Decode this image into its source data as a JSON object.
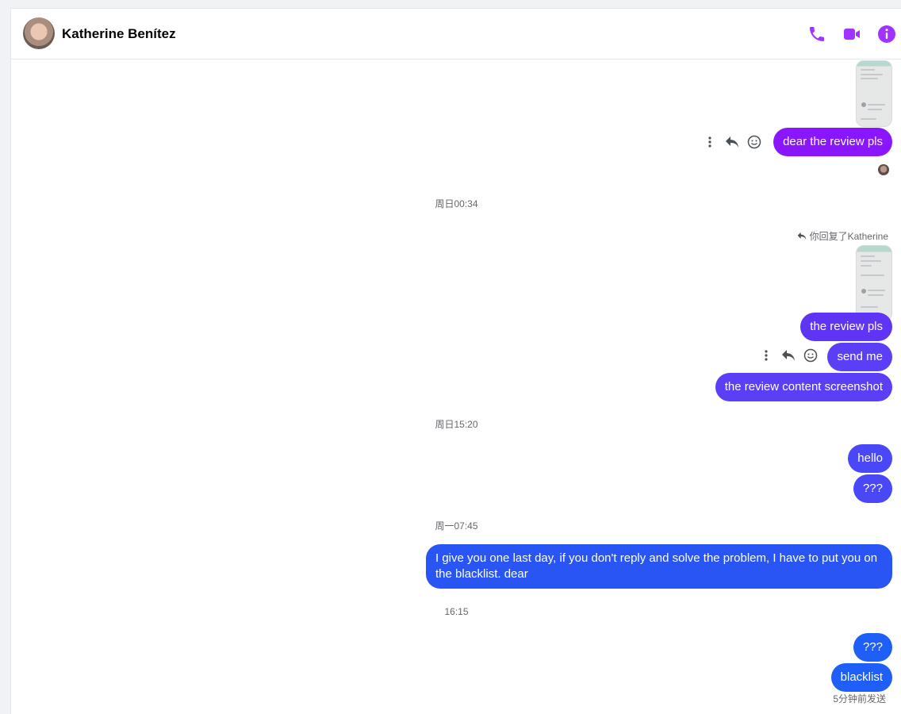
{
  "header": {
    "contact_name": "Katherine Benítez",
    "icons": {
      "phone": "phone-icon",
      "video": "video-camera-icon",
      "info": "info-icon"
    },
    "accent_color": "#a033ff"
  },
  "thread": {
    "messages": [
      {
        "text": "dear the review pls",
        "color": "#8a16ff"
      },
      {
        "text": "the review pls",
        "color": "#5e35f5"
      },
      {
        "text": "send me",
        "color": "#5b3ff6"
      },
      {
        "text": "the review content screenshot",
        "color": "#5b3ff6"
      },
      {
        "text": "hello",
        "color": "#4a47f6"
      },
      {
        "text": "???",
        "color": "#4a47f6"
      },
      {
        "text": "I give you one last day, if you don't reply and solve the problem, I have to put you on the blacklist. dear",
        "color": "#2a55f5"
      },
      {
        "text": "???",
        "color": "#1f5ff7"
      },
      {
        "text": "blacklist",
        "color": "#1f5ff7"
      }
    ],
    "timestamps": [
      "周日00:34",
      "周日15:20",
      "周一07:45",
      "16:15"
    ],
    "reply_note": "你回复了Katherine",
    "sent_note": "5分钟前发送"
  }
}
